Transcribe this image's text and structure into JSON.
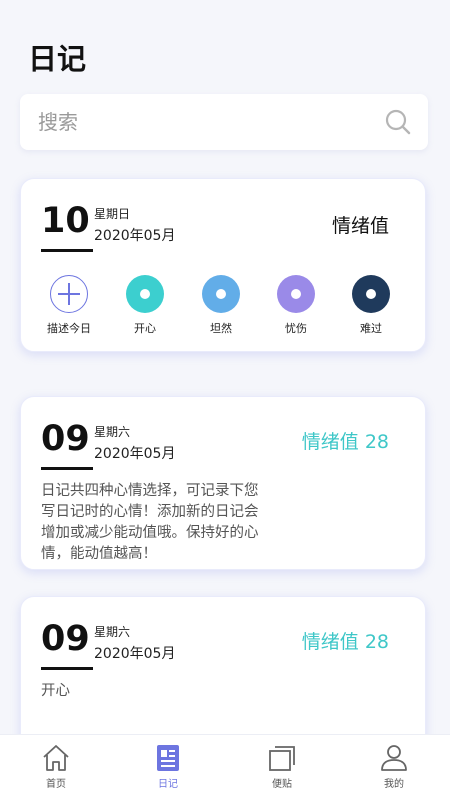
{
  "header": {
    "title": "日记"
  },
  "search": {
    "placeholder": "搜索",
    "value": ""
  },
  "today_card": {
    "day": "10",
    "weekday": "星期日",
    "month": "2020年05月",
    "mood_label": "情绪值",
    "moods": [
      {
        "label": "描述今日",
        "icon": "plus-icon"
      },
      {
        "label": "开心",
        "color": "#3ccfcf"
      },
      {
        "label": "坦然",
        "color": "#62ade8"
      },
      {
        "label": "忧伤",
        "color": "#9a8ae8"
      },
      {
        "label": "难过",
        "color": "#1f3a5c"
      }
    ]
  },
  "entries": [
    {
      "day": "09",
      "weekday": "星期六",
      "month": "2020年05月",
      "mood_value": "情绪值 28",
      "text": "日记共四种心情选择，可记录下您写日记时的心情！添加新的日记会增加或减少能动值哦。保持好的心情，能动值越高！"
    },
    {
      "day": "09",
      "weekday": "星期六",
      "month": "2020年05月",
      "mood_value": "情绪值 28",
      "text": "开心"
    }
  ],
  "tabbar": {
    "tabs": [
      {
        "label": "首页",
        "icon": "home-icon"
      },
      {
        "label": "日记",
        "icon": "diary-icon",
        "active": true
      },
      {
        "label": "便贴",
        "icon": "notes-icon"
      },
      {
        "label": "我的",
        "icon": "user-icon"
      }
    ]
  },
  "colors": {
    "accent": "#6d75e0",
    "teal": "#3fc7c8"
  }
}
